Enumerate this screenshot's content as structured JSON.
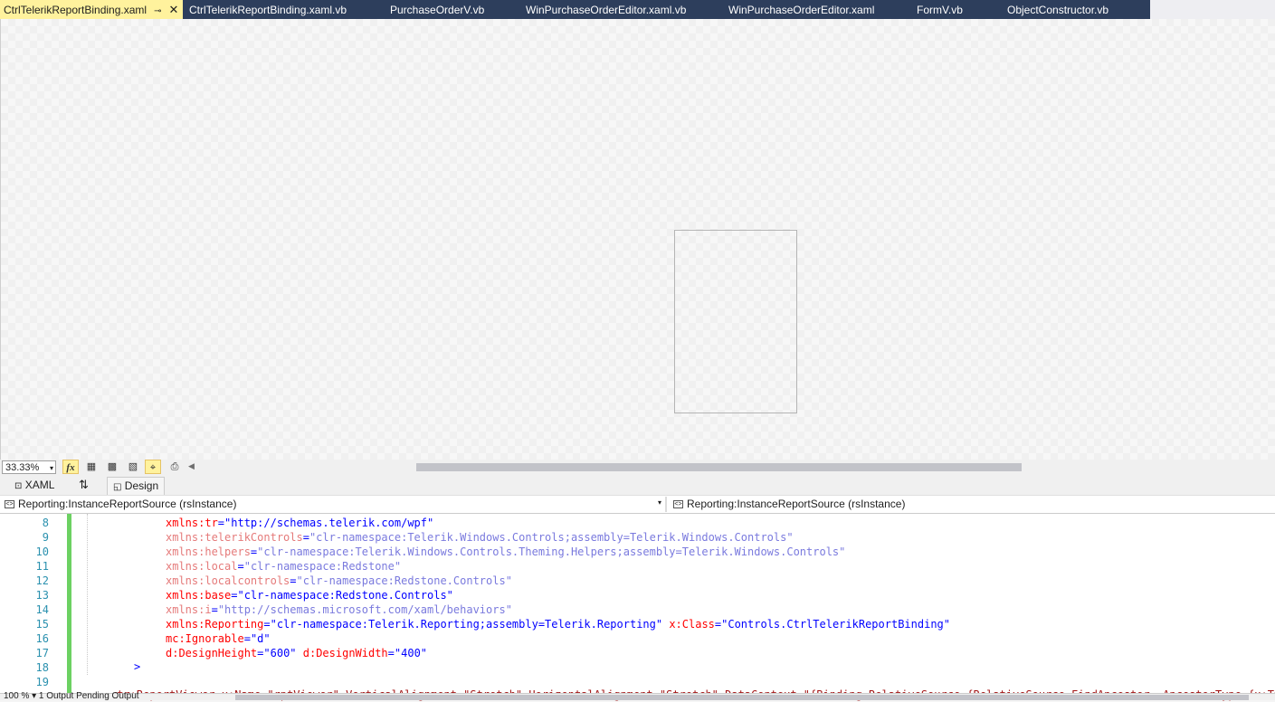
{
  "tabs": [
    {
      "label": "CtrlTelerikReportBinding.xaml",
      "active": true
    },
    {
      "label": "CtrlTelerikReportBinding.xaml.vb"
    },
    {
      "label": "PurchaseOrderV.vb"
    },
    {
      "label": "WinPurchaseOrderEditor.xaml.vb"
    },
    {
      "label": "WinPurchaseOrderEditor.xaml"
    },
    {
      "label": "FormV.vb"
    },
    {
      "label": "ObjectConstructor.vb"
    }
  ],
  "tab_icons": {
    "pin": "⊸",
    "close": "✕"
  },
  "zoom": {
    "value": "33.33%",
    "arrow": "▾"
  },
  "zoom_tools": {
    "fx": "fx",
    "grid": "▦",
    "grid2": "▩",
    "checker": "▧",
    "snap": "⌖",
    "export": "⎙",
    "scroll_left": "◀"
  },
  "split": {
    "xaml_label": "XAML",
    "swap_icon": "⇅",
    "design_label": "Design",
    "xaml_icon": "⊡",
    "design_icon": "◱"
  },
  "navbar": {
    "left_combo": "Reporting:InstanceReportSource (rsInstance)",
    "right_combo": "Reporting:InstanceReportSource (rsInstance)",
    "dropdown_arrow": "▾"
  },
  "code_lines": [
    {
      "num": "8",
      "attr": "xmlns:tr",
      "value": "\"http://schemas.telerik.com/wpf\"",
      "style": "active"
    },
    {
      "num": "9",
      "attr": "xmlns:telerikControls",
      "value": "\"clr-namespace:Telerik.Windows.Controls;assembly=Telerik.Windows.Controls\"",
      "style": "grey"
    },
    {
      "num": "10",
      "attr": "xmlns:helpers",
      "value": "\"clr-namespace:Telerik.Windows.Controls.Theming.Helpers;assembly=Telerik.Windows.Controls\"",
      "style": "grey"
    },
    {
      "num": "11",
      "attr": "xmlns:local",
      "value": "\"clr-namespace:Redstone\"",
      "style": "grey"
    },
    {
      "num": "12",
      "attr": "xmlns:localcontrols",
      "value": "\"clr-namespace:Redstone.Controls\"",
      "style": "grey"
    },
    {
      "num": "13",
      "attr": "xmlns:base",
      "value": "\"clr-namespace:Redstone.Controls\"",
      "style": "active"
    },
    {
      "num": "14",
      "attr": "xmlns:i",
      "value": "\"http://schemas.microsoft.com/xaml/behaviors\"",
      "style": "grey"
    },
    {
      "num": "15",
      "attr": "xmlns:Reporting",
      "value": "\"clr-namespace:Telerik.Reporting;assembly=Telerik.Reporting\"",
      "attr2": " x:Class",
      "value2": "\"Controls.CtrlTelerikReportBinding\"",
      "style": "active"
    },
    {
      "num": "16",
      "attr": "mc:Ignorable",
      "value": "\"d\"",
      "style": "active"
    },
    {
      "num": "17",
      "attr": "d:DesignHeight",
      "value": "\"600\"",
      "attr2": " d:DesignWidth",
      "value2": "\"400\"",
      "style": "active"
    },
    {
      "num": "18",
      "attr": "",
      "value": "",
      "style": "active"
    },
    {
      "num": "19",
      "attr": "",
      "value": "",
      "style": "active"
    }
  ],
  "closing_bracket": ">",
  "bottom_code": "<tr:ReportViewer x:Name=\"rptViewer\" VerticalAlignment=\"Stretch\" HorizontalAlignment=\"Stretch\" DataContext=\"{Binding RelativeSource={RelativeSource FindAncestor, AncestorType={x:Type",
  "status_text": "100 %   ▾   1 Output   Pending Output",
  "colors": {
    "tab_bar": "#2d3e5c",
    "active_tab": "#fff29d",
    "change_bar": "#6cd162",
    "line_number": "#2b91af"
  }
}
